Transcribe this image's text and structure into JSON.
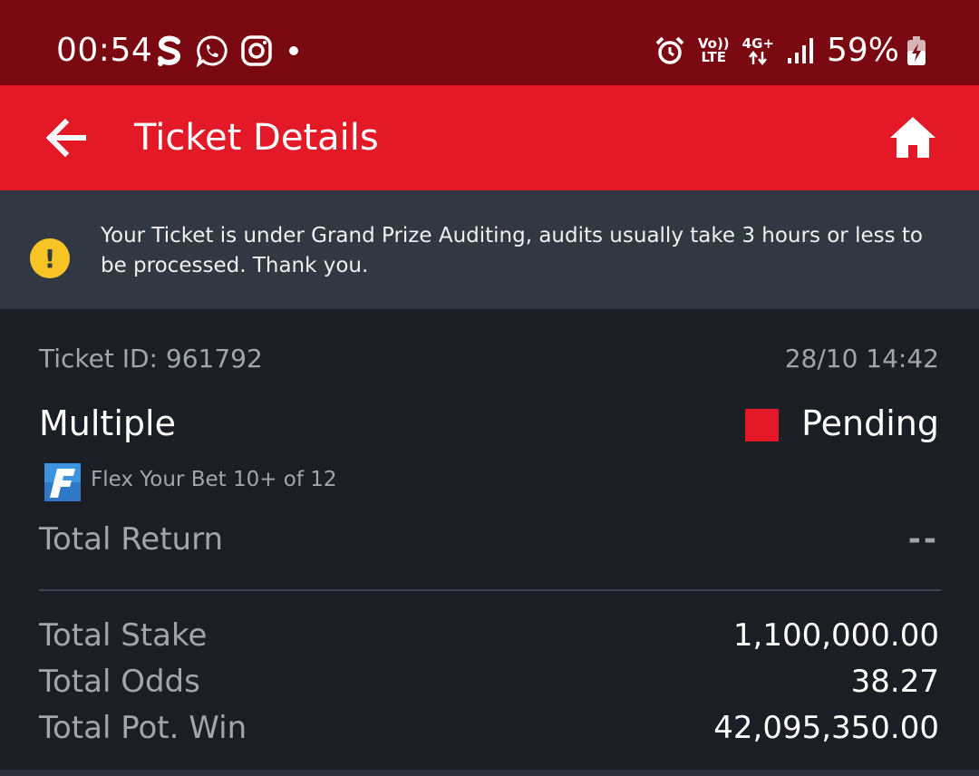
{
  "status_bar": {
    "time": "00:54",
    "battery": "59%",
    "network_volte": "Vo))",
    "network_lte": "LTE",
    "network_gen": "4G+",
    "icons_left": [
      "s-app-icon",
      "whatsapp-icon",
      "instagram-icon",
      "notification-dot-icon"
    ],
    "icons_right": [
      "alarm-icon",
      "volte-icon",
      "data-arrows-icon",
      "signal-icon",
      "battery-charging-icon"
    ]
  },
  "app_bar": {
    "title": "Ticket Details",
    "background": "#e31928"
  },
  "notice": {
    "text": "Your Ticket is under Grand Prize Auditing, audits usually take 3 hours or less to be processed. Thank you.",
    "icon": "warning-icon",
    "icon_color": "#f7c325"
  },
  "ticket": {
    "id_label": "Ticket ID: 961792",
    "date": "28/10 14:42",
    "bet_type": "Multiple",
    "status": "Pending",
    "status_color": "#e31928",
    "flex_label": "Flex Your Bet 10+ of 12",
    "total_return_label": "Total Return",
    "total_return_value": "--",
    "rows": [
      {
        "label": "Total Stake",
        "value": "1,100,000.00"
      },
      {
        "label": "Total Odds",
        "value": "38.27"
      },
      {
        "label": "Total Pot. Win",
        "value": "42,095,350.00"
      }
    ]
  }
}
